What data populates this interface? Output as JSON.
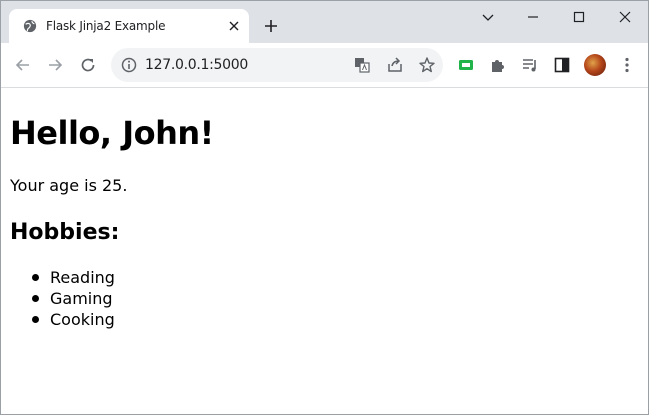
{
  "browser": {
    "tab_title": "Flask Jinja2 Example",
    "url": "127.0.0.1:5000",
    "icons": [
      "globe-icon",
      "close-icon",
      "plus-icon",
      "chevron-down-icon",
      "minimize-icon",
      "maximize-icon",
      "window-close-icon",
      "back-icon",
      "forward-icon",
      "reload-icon",
      "info-icon",
      "translate-icon",
      "share-icon",
      "star-icon",
      "extension-green-icon",
      "puzzle-icon",
      "media-queue-icon",
      "side-panel-icon",
      "avatar",
      "kebab-menu-icon"
    ]
  },
  "page": {
    "heading": "Hello, John!",
    "age_text": "Your age is 25.",
    "hobbies_heading": "Hobbies:",
    "hobbies": [
      "Reading",
      "Gaming",
      "Cooking"
    ]
  }
}
